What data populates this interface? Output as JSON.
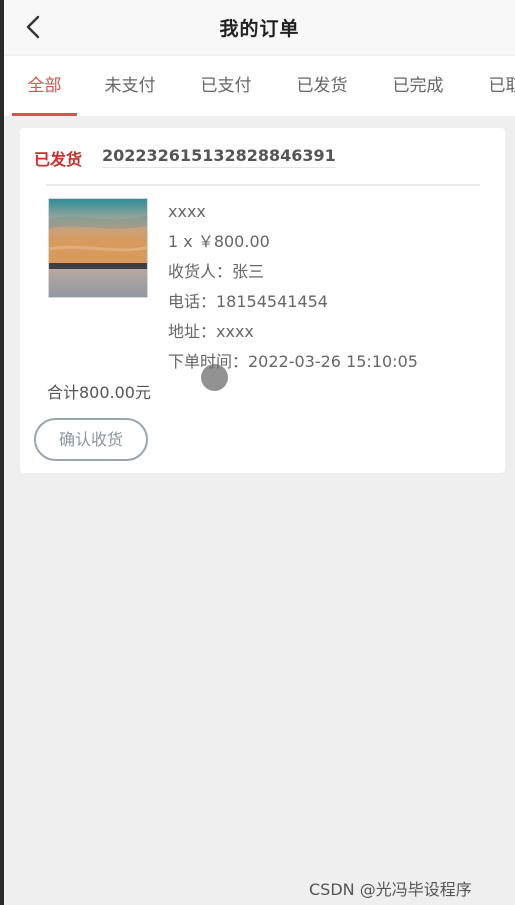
{
  "header": {
    "title": "我的订单",
    "back_icon": "chevron-left-icon"
  },
  "tabs": [
    {
      "label": "全部",
      "active": true
    },
    {
      "label": "未支付",
      "active": false
    },
    {
      "label": "已支付",
      "active": false
    },
    {
      "label": "已发货",
      "active": false
    },
    {
      "label": "已完成",
      "active": false
    },
    {
      "label": "已取消",
      "active": false
    }
  ],
  "order": {
    "status": "已发货",
    "order_no": "20223261513282884639​1",
    "product_name": "xxxx",
    "qty_price": "1 x ￥800.00",
    "receiver": "收货人：张三",
    "phone": "电话：18154541454",
    "address": "地址：xxxx",
    "order_time": "下单时间：2022-03-26 15:10:05",
    "total": "合计800.00元",
    "confirm_label": "确认收货"
  },
  "colors": {
    "accent": "#d9534f",
    "status": "#c9302c",
    "background": "#efefef"
  },
  "watermark": "CSDN @光冯毕设程序"
}
